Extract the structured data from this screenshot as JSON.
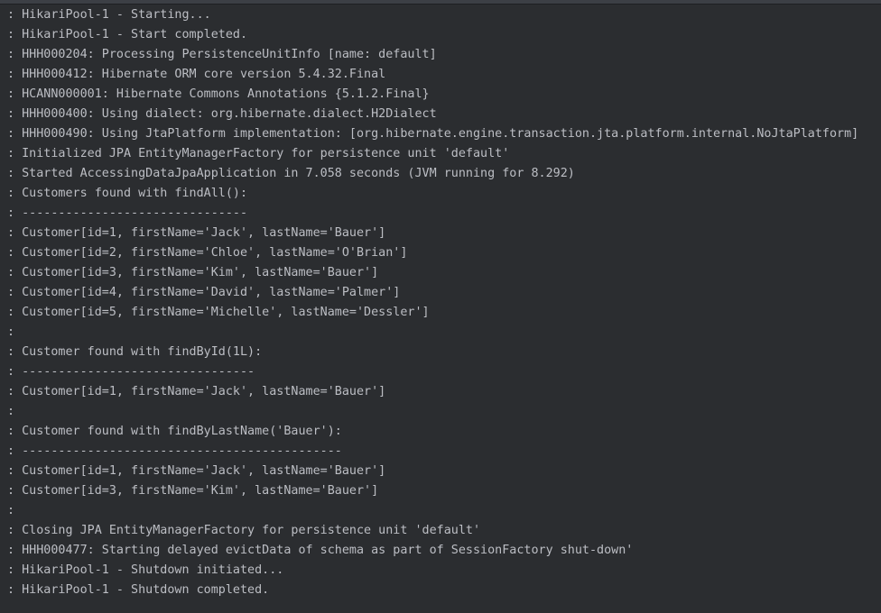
{
  "console": {
    "lines": [
      ": HikariPool-1 - Starting...",
      ": HikariPool-1 - Start completed.",
      ": HHH000204: Processing PersistenceUnitInfo [name: default]",
      ": HHH000412: Hibernate ORM core version 5.4.32.Final",
      ": HCANN000001: Hibernate Commons Annotations {5.1.2.Final}",
      ": HHH000400: Using dialect: org.hibernate.dialect.H2Dialect",
      ": HHH000490: Using JtaPlatform implementation: [org.hibernate.engine.transaction.jta.platform.internal.NoJtaPlatform]",
      ": Initialized JPA EntityManagerFactory for persistence unit 'default'",
      ": Started AccessingDataJpaApplication in 7.058 seconds (JVM running for 8.292)",
      ": Customers found with findAll():",
      ": -------------------------------",
      ": Customer[id=1, firstName='Jack', lastName='Bauer']",
      ": Customer[id=2, firstName='Chloe', lastName='O'Brian']",
      ": Customer[id=3, firstName='Kim', lastName='Bauer']",
      ": Customer[id=4, firstName='David', lastName='Palmer']",
      ": Customer[id=5, firstName='Michelle', lastName='Dessler']",
      ":",
      ": Customer found with findById(1L):",
      ": --------------------------------",
      ": Customer[id=1, firstName='Jack', lastName='Bauer']",
      ":",
      ": Customer found with findByLastName('Bauer'):",
      ": --------------------------------------------",
      ": Customer[id=1, firstName='Jack', lastName='Bauer']",
      ": Customer[id=3, firstName='Kim', lastName='Bauer']",
      ":",
      ": Closing JPA EntityManagerFactory for persistence unit 'default'",
      ": HHH000477: Starting delayed evictData of schema as part of SessionFactory shut-down'",
      ": HikariPool-1 - Shutdown initiated...",
      ": HikariPool-1 - Shutdown completed."
    ]
  },
  "colors": {
    "background": "#2b2d30",
    "text": "#bcbec4"
  }
}
